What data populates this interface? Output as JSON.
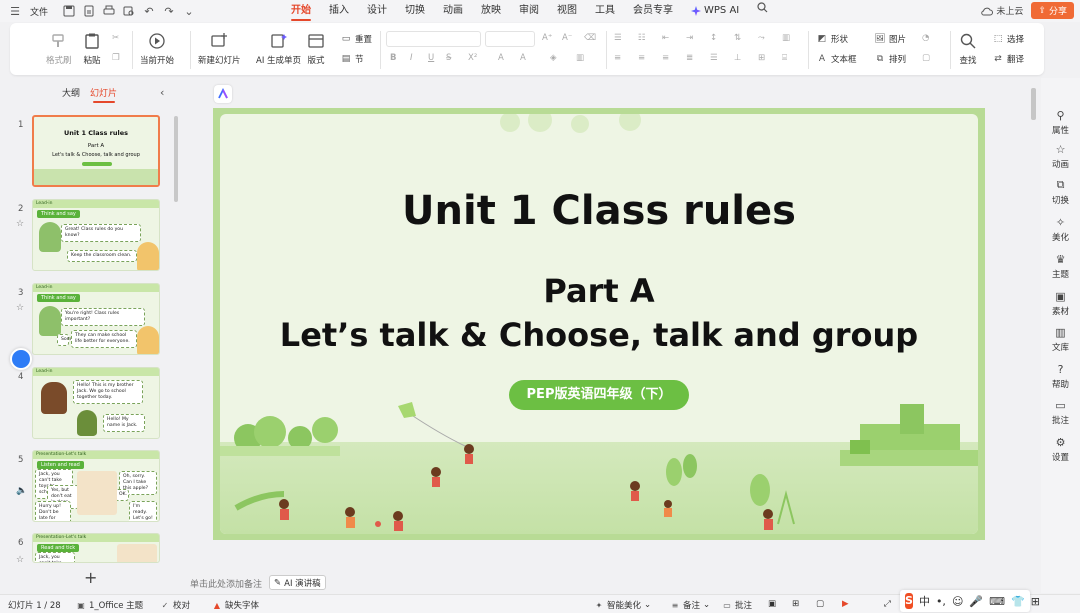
{
  "topbar": {
    "file_label": "文件",
    "tabs": [
      "开始",
      "插入",
      "设计",
      "切换",
      "动画",
      "放映",
      "审阅",
      "视图",
      "工具",
      "会员专享"
    ],
    "ai_label": "WPS AI",
    "cloud_label": "未上云",
    "share_label": "分享"
  },
  "ribbon": {
    "format_painter": "格式刷",
    "paste": "粘贴",
    "start_from_current": "当前开始",
    "new_slide": "新建幻灯片",
    "ai_generate": "AI 生成单页",
    "layout": "版式",
    "reset": "重置",
    "section": "节",
    "shape": "形状",
    "picture": "图片",
    "textbox": "文本框",
    "arrange": "排列",
    "find": "查找",
    "select": "选择",
    "translate": "翻译"
  },
  "left_panel": {
    "tab_outline": "大纲",
    "tab_slides": "幻灯片",
    "slide_numbers": [
      "1",
      "2",
      "3",
      "4",
      "5",
      "6"
    ],
    "thumb1": {
      "title": "Unit 1  Class rules",
      "part": "Part A",
      "sub": "Let's talk & Choose, talk and group"
    },
    "thumb2": {
      "header": "Lead-in",
      "tag": "Think and say",
      "bubble1": "Great! Class rules do you know?",
      "bubble2": "Keep the classroom clean."
    },
    "thumb3": {
      "header": "Lead-in",
      "tag": "Think and say",
      "bubble1": "You're right! Class rules important?",
      "bubble2": "They can make school life better for everyone.",
      "bubble3": "Som"
    },
    "thumb4": {
      "header": "Lead-in",
      "bubble1": "Hello! This is my brother Jack. We go to school together today.",
      "bubble2": "Hello! My name is Jack."
    },
    "thumb5": {
      "header": "Presentation-Let's talk",
      "tag": "Listen and read",
      "bubble1": "Jack, you can't take toys to school!",
      "bubble2": "Yes, but don't eat in class.",
      "bubble3": "Oh, sorry. Can I take this apple?",
      "bubble4": "OK.",
      "bubble5": "Hurry up! Don't be late for class.",
      "bubble6": "I'm ready. Let's go!"
    },
    "thumb6": {
      "header": "Presentation-Let's talk",
      "tag": "Read and tick",
      "bubble1": "Jack, you can't take toys to school!"
    }
  },
  "slide": {
    "title": "Unit 1   Class rules",
    "part": "Part A",
    "subtitle": "Let’s talk & Choose, talk and group",
    "pill": "PEP版英语四年级（下）"
  },
  "right_sidebar": [
    "属性",
    "动画",
    "切换",
    "美化",
    "主题",
    "素材",
    "文库",
    "帮助",
    "批注",
    "设置"
  ],
  "notes": {
    "placeholder": "单击此处添加备注",
    "ai_talk": "AI 演讲稿"
  },
  "status": {
    "slide_count": "幻灯片 1 / 28",
    "theme": "1_Office 主题",
    "proof": "校对",
    "missing_font": "缺失字体",
    "smart_beautify": "智能美化",
    "notes": "备注",
    "comments": "批注"
  },
  "ime": {
    "lang": "中"
  },
  "colors": {
    "accent": "#e5482b",
    "share": "#f06a35",
    "slide_border": "#b8db95",
    "pill": "#6cbf43"
  }
}
